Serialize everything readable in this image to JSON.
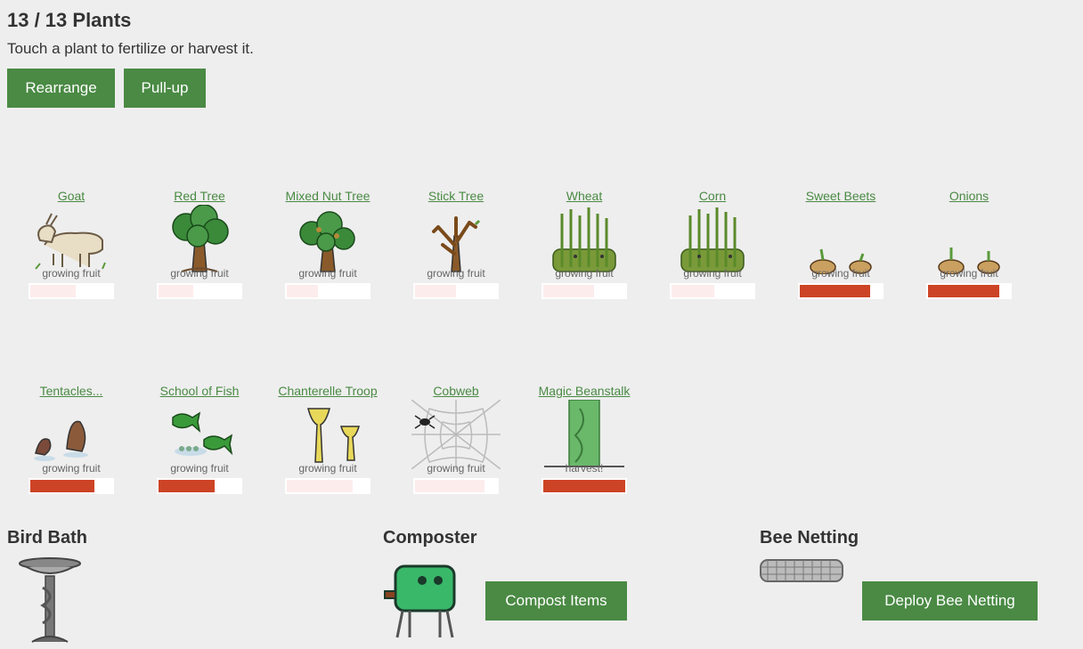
{
  "header": {
    "title": "13 / 13 Plants",
    "subtitle": "Touch a plant to fertilize or harvest it."
  },
  "buttons": {
    "rearrange": "Rearrange",
    "pullup": "Pull-up"
  },
  "plants": [
    {
      "name": "Goat",
      "status": "growing fruit",
      "progress": 0.55,
      "bar": "pale"
    },
    {
      "name": "Red Tree",
      "status": "growing fruit",
      "progress": 0.42,
      "bar": "pale"
    },
    {
      "name": "Mixed Nut Tree",
      "status": "growing fruit",
      "progress": 0.38,
      "bar": "pale"
    },
    {
      "name": "Stick Tree",
      "status": "growing fruit",
      "progress": 0.5,
      "bar": "pale"
    },
    {
      "name": "Wheat",
      "status": "growing fruit",
      "progress": 0.62,
      "bar": "pale"
    },
    {
      "name": "Corn",
      "status": "growing fruit",
      "progress": 0.52,
      "bar": "pale"
    },
    {
      "name": "Sweet Beets",
      "status": "growing fruit",
      "progress": 0.86,
      "bar": "red"
    },
    {
      "name": "Onions",
      "status": "growing fruit",
      "progress": 0.87,
      "bar": "red"
    },
    {
      "name": "Tentacles...",
      "status": "growing fruit",
      "progress": 0.78,
      "bar": "red"
    },
    {
      "name": "School of Fish",
      "status": "growing fruit",
      "progress": 0.68,
      "bar": "red"
    },
    {
      "name": "Chanterelle Troop",
      "status": "growing fruit",
      "progress": 0.8,
      "bar": "pale"
    },
    {
      "name": "Cobweb",
      "status": "growing fruit",
      "progress": 0.85,
      "bar": "pale"
    },
    {
      "name": "Magic Beanstalk",
      "status": "harvest!",
      "progress": 1.0,
      "bar": "red"
    }
  ],
  "sections": {
    "bird_bath": {
      "title": "Bird Bath"
    },
    "composter": {
      "title": "Composter",
      "button": "Compost Items"
    },
    "bee_netting": {
      "title": "Bee Netting",
      "button": "Deploy Bee Netting"
    }
  },
  "colors": {
    "accent": "#4a8a44",
    "bar_red": "#cc4425",
    "bar_pale": "#fdecec"
  }
}
